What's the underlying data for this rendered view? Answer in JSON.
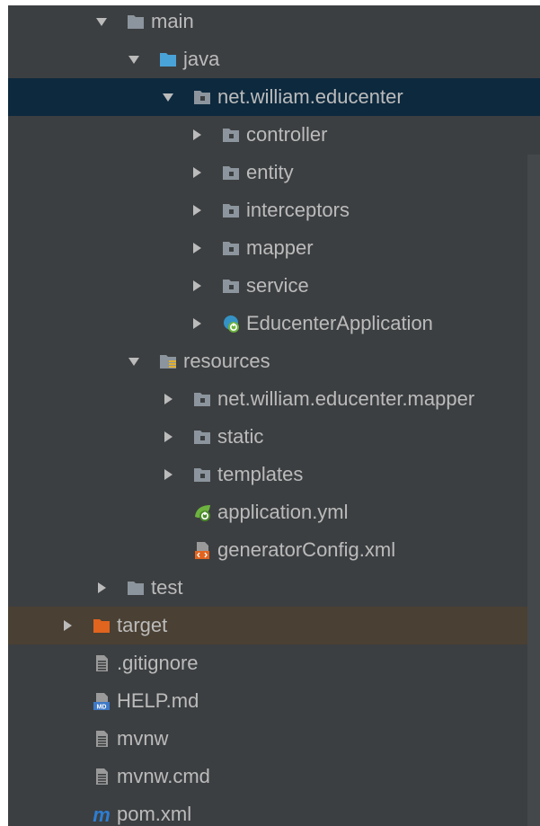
{
  "project_tree": {
    "items": [
      {
        "label": "main",
        "icon": "folder-icon",
        "expanded": true
      },
      {
        "label": "java",
        "icon": "source-folder-icon",
        "expanded": true
      },
      {
        "label": "net.william.educenter",
        "icon": "package-icon",
        "expanded": true,
        "selected": true
      },
      {
        "label": "controller",
        "icon": "package-icon",
        "expanded": false
      },
      {
        "label": "entity",
        "icon": "package-icon",
        "expanded": false
      },
      {
        "label": "interceptors",
        "icon": "package-icon",
        "expanded": false
      },
      {
        "label": "mapper",
        "icon": "package-icon",
        "expanded": false
      },
      {
        "label": "service",
        "icon": "package-icon",
        "expanded": false
      },
      {
        "label": "EducenterApplication",
        "icon": "spring-boot-class-icon",
        "expanded": false
      },
      {
        "label": "resources",
        "icon": "resources-folder-icon",
        "expanded": true
      },
      {
        "label": "net.william.educenter.mapper",
        "icon": "package-icon",
        "expanded": false
      },
      {
        "label": "static",
        "icon": "package-icon",
        "expanded": false
      },
      {
        "label": "templates",
        "icon": "package-icon",
        "expanded": false
      },
      {
        "label": "application.yml",
        "icon": "spring-config-icon"
      },
      {
        "label": "generatorConfig.xml",
        "icon": "xml-file-icon"
      },
      {
        "label": "test",
        "icon": "folder-icon",
        "expanded": false
      },
      {
        "label": "target",
        "icon": "excluded-folder-icon",
        "expanded": false,
        "excluded": true
      },
      {
        "label": ".gitignore",
        "icon": "text-file-icon"
      },
      {
        "label": "HELP.md",
        "icon": "markdown-file-icon"
      },
      {
        "label": "mvnw",
        "icon": "text-file-icon"
      },
      {
        "label": "mvnw.cmd",
        "icon": "text-file-icon"
      },
      {
        "label": "pom.xml",
        "icon": "maven-icon"
      }
    ]
  },
  "colors": {
    "background": "#3c3f41",
    "text": "#bbbbbb",
    "selection": "#0d293e",
    "excluded_row": "#4a4033",
    "folder_grey": "#8c959d",
    "source_blue": "#4aa3d8",
    "excluded_orange": "#e1641f"
  }
}
